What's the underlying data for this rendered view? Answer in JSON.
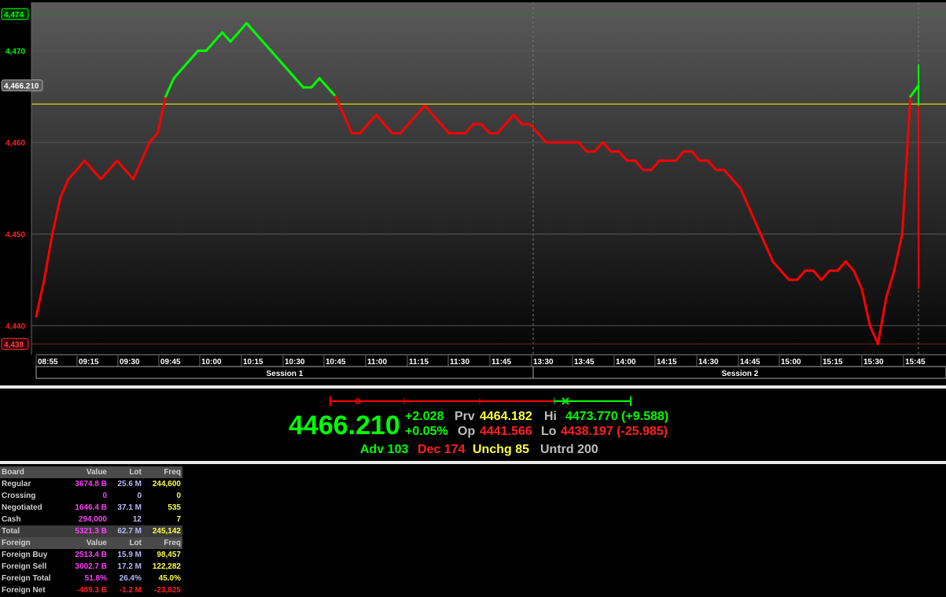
{
  "chart_data": {
    "type": "line",
    "title": "",
    "y_ticks": [
      "4,440",
      "4,450",
      "4,460",
      "4,470"
    ],
    "ylim": [
      4437,
      4476
    ],
    "x_ticks": [
      "08:55",
      "09:15",
      "09:30",
      "09:45",
      "10:00",
      "10:15",
      "10:30",
      "10:45",
      "11:00",
      "11:15",
      "11:30",
      "11:45",
      "13:30",
      "13:45",
      "14:00",
      "14:15",
      "14:30",
      "14:45",
      "15:00",
      "15:15",
      "15:30",
      "15:45"
    ],
    "sessions": [
      "Session 1",
      "Session 2"
    ],
    "previous_close": 4464.182,
    "high_marker": "4,474",
    "low_marker": "4,438",
    "last_marker": "4,466.210",
    "colors": {
      "up": "#00ff00",
      "down": "#ff0000",
      "prev_line": "#ffff00"
    },
    "series": [
      {
        "values": [
          4441,
          4445,
          4450,
          4454,
          4456,
          4457,
          4458,
          4457,
          4456,
          4457,
          4458,
          4457,
          4456,
          4458,
          4460,
          4461,
          4465,
          4467,
          4468,
          4469,
          4470,
          4470,
          4471,
          4472,
          4471,
          4472,
          4473,
          4472,
          4471,
          4470,
          4469,
          4468,
          4467,
          4466,
          4466,
          4467,
          4466,
          4465,
          4463,
          4461,
          4461,
          4462,
          4463,
          4462,
          4461,
          4461,
          4462,
          4463,
          4464,
          4463,
          4462,
          4461,
          4461,
          4461,
          4462,
          4462,
          4461,
          4461,
          4462,
          4463,
          4462,
          4462,
          4461,
          4460,
          4460,
          4460,
          4460,
          4460,
          4459,
          4459,
          4460,
          4459,
          4459,
          4458,
          4458,
          4457,
          4457,
          4458,
          4458,
          4458,
          4459,
          4459,
          4458,
          4458,
          4457,
          4457,
          4456,
          4455,
          4453,
          4451,
          4449,
          4447,
          4446,
          4445,
          4445,
          4446,
          4446,
          4445,
          4446,
          4446,
          4447,
          4446,
          4444,
          4440,
          4438,
          4443,
          4446,
          4450,
          4465,
          4466.21
        ]
      }
    ]
  },
  "summary": {
    "last": "4466.210",
    "change": "+2.028",
    "change_pct": "+0.05%",
    "prv_label": "Prv",
    "prv": "4464.182",
    "op_label": "Op",
    "op": "4441.566",
    "hi_label": "Hi",
    "hi": "4473.770 (+9.588)",
    "lo_label": "Lo",
    "lo": "4438.197 (-25.985)",
    "adv": "Adv 103",
    "dec": "Dec 174",
    "unchg": "Unchg 85",
    "untrd": "Untrd 200"
  },
  "board": {
    "header": [
      "Board",
      "Value",
      "Lot",
      "Freq"
    ],
    "rows": [
      [
        "Regular",
        "3674.8 B",
        "25.6 M",
        "244,600"
      ],
      [
        "Crossing",
        "0",
        "0",
        "0"
      ],
      [
        "Negotiated",
        "1646.4 B",
        "37.1 M",
        "535"
      ],
      [
        "Cash",
        "294,000",
        "12",
        "7"
      ],
      [
        "Total",
        "5321.3 B",
        "62.7 M",
        "245,142"
      ]
    ],
    "foreign_header": [
      "Foreign",
      "Value",
      "Lot",
      "Freq"
    ],
    "foreign_rows": [
      [
        "Foreign Buy",
        "2513.4 B",
        "15.9 M",
        "98,457"
      ],
      [
        "Foreign Sell",
        "3002.7 B",
        "17.2 M",
        "122,282"
      ],
      [
        "Foreign Total",
        "51.8%",
        "26.4%",
        "45.0%"
      ],
      [
        "Foreign Net",
        "-489.3 B",
        "-1.2 M",
        "-23,825"
      ]
    ]
  }
}
